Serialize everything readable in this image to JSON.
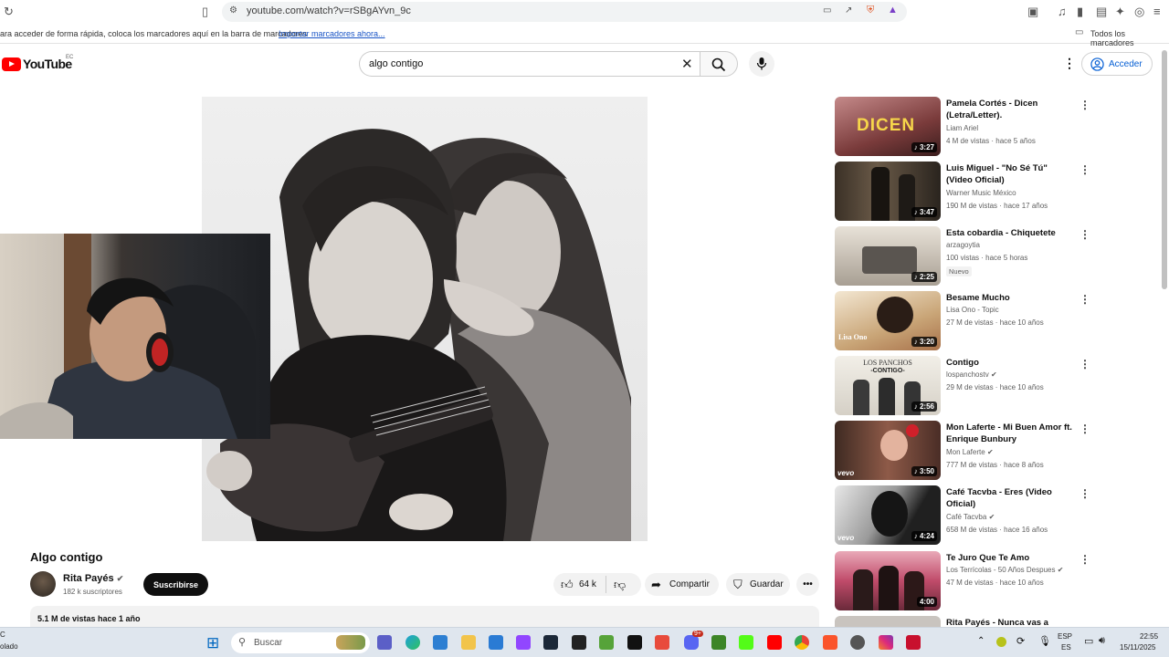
{
  "browser": {
    "url": "youtube.com/watch?v=rSBgAYvn_9c",
    "bookmarks_hint": "ara acceder de forma rápida, coloca los marcadores aquí en la barra de marcadores",
    "import_link": "Importar marcadores ahora...",
    "all_bookmarks": "Todos los marcadores"
  },
  "header": {
    "logo": "YouTube",
    "country": "EC",
    "search_value": "algo contigo",
    "signin_label": "Acceder"
  },
  "video": {
    "title": "Algo contigo",
    "channel": "Rita Payés",
    "subscribers": "182 k suscriptores",
    "subscribe_label": "Suscribirse",
    "likes": "64 k",
    "share_label": "Compartir",
    "save_label": "Guardar",
    "views_date": "5.1 M de vistas  hace 1 año"
  },
  "recommendations": [
    {
      "title": "Pamela Cortés - Dicen (Letra/Letter).",
      "channel": "Liam Ariel",
      "meta": "4 M de vistas · hace 5 años",
      "duration": "3:27",
      "thumb_text": "DICEN"
    },
    {
      "title": "Luis Miguel - \"No Sé Tú\" (Video Oficial)",
      "channel": "Warner Music México",
      "meta": "190 M de vistas · hace 17 años",
      "duration": "3:47"
    },
    {
      "title": "Esta cobardia - Chiquetete",
      "channel": "arzagoytia",
      "meta": "100 vistas · hace 5 horas",
      "duration": "2:25",
      "badge": "Nuevo"
    },
    {
      "title": "Besame Mucho",
      "channel": "Lisa Ono - Topic",
      "meta": "27 M de vistas · hace 10 años",
      "duration": "3:20",
      "thumb_text": "Lisa Ono"
    },
    {
      "title": "Contigo",
      "channel": "lospanchostv",
      "meta": "29 M de vistas · hace 10 años",
      "duration": "2:56",
      "thumb_text": "LOS PANCHOS",
      "thumb_sub": "-CONTIGO-"
    },
    {
      "title": "Mon Laferte - Mi Buen Amor ft. Enrique Bunbury",
      "channel": "Mon Laferte",
      "meta": "777 M de vistas · hace 8 años",
      "duration": "3:50",
      "vevo": "vevo"
    },
    {
      "title": "Café Tacvba - Eres (Video Oficial)",
      "channel": "Café Tacvba",
      "meta": "658 M de vistas · hace 16 años",
      "duration": "4:24",
      "vevo": "vevo"
    },
    {
      "title": "Te Juro Que Te Amo",
      "channel": "Los Terrícolas - 50 Años Despues",
      "meta": "47 M de vistas · hace 10 años",
      "duration": "4:00"
    },
    {
      "title": "Rita Payés - Nunca vas a"
    }
  ],
  "taskbar": {
    "search_placeholder": "Buscar",
    "left_label_1": "C",
    "left_label_2": "olado",
    "lang_1": "ESP",
    "lang_2": "ES",
    "time": "22:55",
    "date": "15/11/2025",
    "notif_badge": "9+"
  },
  "colors": {
    "accent": "#065fd4",
    "brand": "#ff0000",
    "subscribe": "#0f0f0f"
  }
}
